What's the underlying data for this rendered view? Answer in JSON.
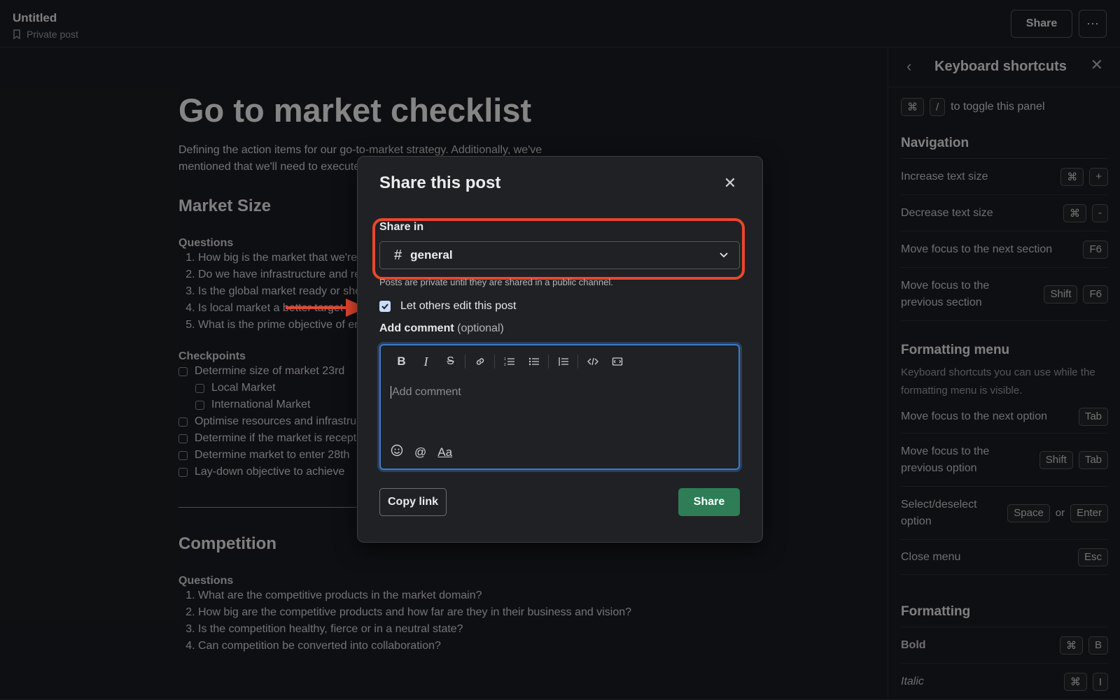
{
  "header": {
    "title": "Untitled",
    "subtitle": "Private post",
    "share_label": "Share",
    "more_label": "⋯"
  },
  "document": {
    "title": "Go to market checklist",
    "intro": "Defining  the action items for our go-to-market strategy. Additionally, we've mentioned that we'll need to execute on these items.",
    "sections": [
      {
        "heading": "Market Size",
        "questions_label": "Questions",
        "questions": [
          "How big is the market that we're targeting?",
          "Do we have infrastructure and resources to support it?",
          "Is the global market ready or should we focus locally?",
          "Is local market a better target than the global one?",
          "What is the prime objective of entering the market?"
        ],
        "checkpoints_label": "Checkpoints",
        "checkpoints": [
          {
            "text": "Determine size of market 23rd",
            "sub": false
          },
          {
            "text": "Local Market",
            "sub": true
          },
          {
            "text": "International Market",
            "sub": true
          },
          {
            "text": "Optimise resources and infrastructure",
            "sub": false
          },
          {
            "text": "Determine if the market is receptive",
            "sub": false
          },
          {
            "text": "Determine market to enter 28th",
            "sub": false
          },
          {
            "text": "Lay-down objective to achieve",
            "sub": false
          }
        ]
      },
      {
        "heading": "Competition",
        "questions_label": "Questions",
        "questions": [
          "What are the competitive products in the market domain?",
          "How big are the competitive products and how far are they in their business and vision?",
          "Is the competition healthy, fierce or in a neutral state?",
          "Can competition be converted into collaboration?"
        ]
      }
    ]
  },
  "panel": {
    "title": "Keyboard shortcuts",
    "toggle_keys": [
      "⌘",
      "/"
    ],
    "toggle_text": "to toggle this panel",
    "navigation": {
      "heading": "Navigation",
      "rows": [
        {
          "label": "Increase text size",
          "keys": [
            "⌘",
            "+"
          ]
        },
        {
          "label": "Decrease text size",
          "keys": [
            "⌘",
            "-"
          ]
        },
        {
          "label": "Move focus to the next section",
          "keys": [
            "F6"
          ]
        },
        {
          "label": "Move focus to the previous section",
          "keys": [
            "Shift",
            "F6"
          ]
        }
      ]
    },
    "formatting_menu": {
      "heading": "Formatting menu",
      "note": "Keyboard shortcuts you can use while the formatting menu is visible.",
      "rows": [
        {
          "label": "Move focus to the next option",
          "keys": [
            "Tab"
          ]
        },
        {
          "label": "Move focus to the previous option",
          "keys": [
            "Shift",
            "Tab"
          ]
        },
        {
          "label": "Select/deselect option",
          "keys": [
            "Space",
            "Enter"
          ],
          "joiner": "or"
        },
        {
          "label": "Close menu",
          "keys": [
            "Esc"
          ]
        }
      ]
    },
    "formatting": {
      "heading": "Formatting",
      "rows": [
        {
          "label": "Bold",
          "keys": [
            "⌘",
            "B"
          ]
        },
        {
          "label": "Italic",
          "keys": [
            "⌘",
            "I"
          ]
        }
      ]
    }
  },
  "modal": {
    "title": "Share this post",
    "share_in_label": "Share in",
    "channel_value": "general",
    "hint": "Posts are private until they are shared in a public channel.",
    "let_edit_label": "Let others edit this post",
    "let_edit_checked": true,
    "comment_label": "Add comment",
    "comment_optional": "(optional)",
    "comment_placeholder": "Add comment",
    "copy_link_label": "Copy link",
    "share_label": "Share",
    "accent_color": "#2e7d57",
    "highlight_color": "#e8472b"
  }
}
